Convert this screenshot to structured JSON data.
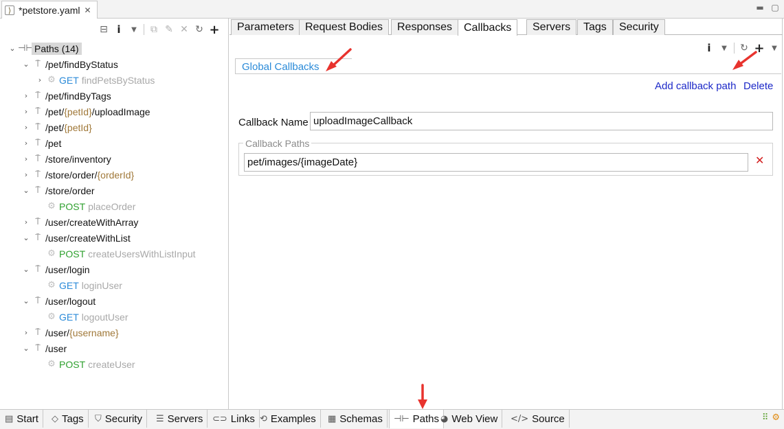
{
  "editor": {
    "tab_title": "*petstore.yaml",
    "file_icon": "yaml-file-icon",
    "close_glyph": "✕"
  },
  "tree": {
    "root_label": "Paths (14)",
    "rows": [
      {
        "kind": "path",
        "expanded": true,
        "parts": [
          {
            "t": "/pet/findByStatus",
            "p": false
          }
        ]
      },
      {
        "kind": "op",
        "verb": "GET",
        "op_id": "findPetsByStatus",
        "has_chev": true
      },
      {
        "kind": "path",
        "expanded": false,
        "parts": [
          {
            "t": "/pet/findByTags",
            "p": false
          }
        ]
      },
      {
        "kind": "path",
        "expanded": false,
        "parts": [
          {
            "t": "/pet/",
            "p": false
          },
          {
            "t": "{petId}",
            "p": true
          },
          {
            "t": "/uploadImage",
            "p": false
          }
        ]
      },
      {
        "kind": "path",
        "expanded": false,
        "parts": [
          {
            "t": "/pet/",
            "p": false
          },
          {
            "t": "{petId}",
            "p": true
          }
        ]
      },
      {
        "kind": "path",
        "expanded": false,
        "parts": [
          {
            "t": "/pet",
            "p": false
          }
        ]
      },
      {
        "kind": "path",
        "expanded": false,
        "parts": [
          {
            "t": "/store/inventory",
            "p": false
          }
        ]
      },
      {
        "kind": "path",
        "expanded": false,
        "parts": [
          {
            "t": "/store/order/",
            "p": false
          },
          {
            "t": "{orderId}",
            "p": true
          }
        ]
      },
      {
        "kind": "path",
        "expanded": true,
        "parts": [
          {
            "t": "/store/order",
            "p": false
          }
        ]
      },
      {
        "kind": "op",
        "verb": "POST",
        "op_id": "placeOrder",
        "has_chev": false
      },
      {
        "kind": "path",
        "expanded": false,
        "parts": [
          {
            "t": "/user/createWithArray",
            "p": false
          }
        ]
      },
      {
        "kind": "path",
        "expanded": true,
        "parts": [
          {
            "t": "/user/createWithList",
            "p": false
          }
        ]
      },
      {
        "kind": "op",
        "verb": "POST",
        "op_id": "createUsersWithListInput",
        "has_chev": false
      },
      {
        "kind": "path",
        "expanded": true,
        "parts": [
          {
            "t": "/user/login",
            "p": false
          }
        ]
      },
      {
        "kind": "op",
        "verb": "GET",
        "op_id": "loginUser",
        "has_chev": false
      },
      {
        "kind": "path",
        "expanded": true,
        "parts": [
          {
            "t": "/user/logout",
            "p": false
          }
        ]
      },
      {
        "kind": "op",
        "verb": "GET",
        "op_id": "logoutUser",
        "has_chev": false
      },
      {
        "kind": "path",
        "expanded": false,
        "parts": [
          {
            "t": "/user/",
            "p": false
          },
          {
            "t": "{username}",
            "p": true
          }
        ]
      },
      {
        "kind": "path",
        "expanded": true,
        "parts": [
          {
            "t": "/user",
            "p": false
          }
        ]
      },
      {
        "kind": "op",
        "verb": "POST",
        "op_id": "createUser",
        "has_chev": false
      }
    ]
  },
  "detail_tabs": [
    "Parameters",
    "Request Bodies",
    "Responses",
    "Callbacks",
    "Servers",
    "Tags",
    "Security"
  ],
  "detail_active": "Callbacks",
  "callbacks": {
    "section_tab": "Global Callbacks",
    "add_link": "Add callback path",
    "delete_link": "Delete",
    "name_label": "Callback Name",
    "name_value": "uploadImageCallback",
    "paths_group_title": "Callback Paths",
    "path_value": "pet/images/{imageDate}"
  },
  "bottom_tabs": [
    {
      "label": "Start",
      "icon": "start-page-icon"
    },
    {
      "label": "Tags",
      "icon": "tag-icon"
    },
    {
      "label": "Security",
      "icon": "shield-icon"
    },
    {
      "label": "Servers",
      "icon": "server-icon"
    },
    {
      "label": "Links",
      "icon": "link-icon"
    },
    {
      "label": "Examples",
      "icon": "examples-icon"
    },
    {
      "label": "Schemas",
      "icon": "schemas-icon"
    },
    {
      "label": "Paths",
      "icon": "paths-icon"
    },
    {
      "label": "Web View",
      "icon": "globe-icon"
    },
    {
      "label": "Source",
      "icon": "code-icon"
    }
  ],
  "bottom_active": "Paths",
  "colors": {
    "get": "#2a8ad8",
    "post": "#2ea02e",
    "param": "#a07838",
    "link": "#1c28c8",
    "annotation_arrow": "#e8332e"
  }
}
